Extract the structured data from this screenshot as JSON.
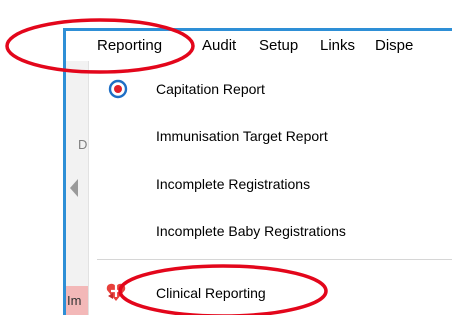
{
  "menubar": {
    "items": [
      {
        "label": "Reporting"
      },
      {
        "label": "Audit"
      },
      {
        "label": "Setup"
      },
      {
        "label": "Links"
      },
      {
        "label": "Dispe"
      }
    ]
  },
  "left_edge": {
    "fragments": [
      "D",
      "Im"
    ]
  },
  "dropdown": {
    "items": [
      {
        "label": "Capitation Report",
        "icon": "radio-target-icon"
      },
      {
        "label": "Immunisation Target Report"
      },
      {
        "label": "Incomplete Registrations"
      },
      {
        "label": "Incomplete Baby Registrations"
      },
      {
        "label": "Clinical Reporting",
        "icon": "clinical-reporting-icon"
      }
    ]
  },
  "colors": {
    "annotation_ellipse": "#e3061b",
    "window_border": "#2e8fd6",
    "radio_outer": "#1f6fc5",
    "radio_inner": "#e0202a"
  }
}
